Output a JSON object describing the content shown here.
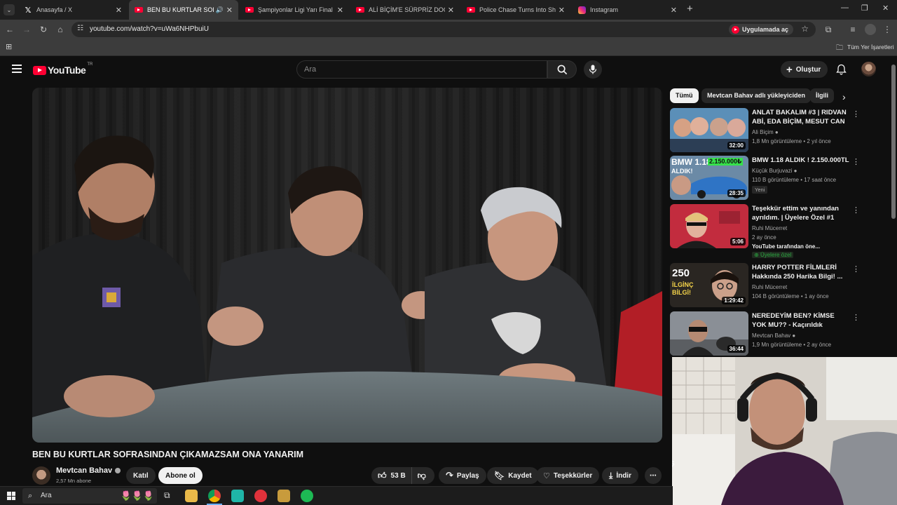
{
  "browser": {
    "tabs": [
      {
        "title": "Anasayfa / X",
        "icon": "x-logo-icon"
      },
      {
        "title": "BEN BU KURTLAR SOFRASIN",
        "icon": "youtube-icon",
        "active": true
      },
      {
        "title": "Şampiyonlar Ligi Yarı Final | Atle",
        "icon": "youtube-icon"
      },
      {
        "title": "ALİ BİÇİM'E SÜRPRİZ DOĞUM G",
        "icon": "youtube-icon"
      },
      {
        "title": "Police Chase Turns Into Shootou",
        "icon": "youtube-icon"
      },
      {
        "title": "Instagram",
        "icon": "instagram-icon"
      }
    ],
    "url": "youtube.com/watch?v=uWa6NHPbuiU",
    "open_in_app": "Uygulamada aç",
    "bookmarks_label": "Tüm Yer İşaretleri"
  },
  "youtube": {
    "logo_text": "YouTube",
    "region": "TR",
    "search_placeholder": "Ara",
    "create_label": "Oluştur"
  },
  "video": {
    "title": "BEN BU KURTLAR SOFRASINDAN ÇIKAMAZSAM ONA YANARIM",
    "channel": "Mevtcan Bahav",
    "subscribers": "2,57 Mn abone",
    "join_label": "Katıl",
    "subscribe_label": "Abone ol",
    "likes": "53 B",
    "share_label": "Paylaş",
    "save_label": "Kaydet",
    "thanks_label": "Teşekkürler",
    "download_label": "İndir"
  },
  "sidebar": {
    "chips": [
      "Tümü",
      "Mevtcan Bahav adlı yükleyiciden",
      "İlgili"
    ],
    "recommendations": [
      {
        "title": "ANLAT BAKALIM #3 | RIDVAN ABİ, EDA BİÇİM, MESUT CAN ...",
        "channel": "Ali Biçim",
        "verified": true,
        "meta": "1,8 Mn görüntüleme • 2 yıl önce",
        "duration": "32:00"
      },
      {
        "title": "BMW 1.18 ALDIK ! 2.150.000TL",
        "channel": "Küçük Burjuvazi",
        "verified": true,
        "meta": "110 B görüntüleme • 17 saat önce",
        "badge": "Yeni",
        "duration": "28:35",
        "thumb_text": "BMW 1.18",
        "thumb_price": "2.150.000₺",
        "thumb_sub": "ALDIK!"
      },
      {
        "title": "Teşekkür ettim ve yanından ayrıldım. | Üyelere Özel #1",
        "channel": "Ruhi Mücerret",
        "verified": false,
        "meta": "2 ay önce",
        "extra": "YouTube tarafından öne...",
        "members": "Üyelere özel",
        "duration": "5:06"
      },
      {
        "title": "HARRY POTTER FİLMLERİ Hakkında 250 Harika Bilgi! ...",
        "channel": "Ruhi Mücerret",
        "verified": false,
        "meta": "104 B görüntüleme • 1 ay önce",
        "duration": "1:29:42",
        "thumb_text": "250",
        "thumb_sub": "İLGİNÇ BİLGİ!"
      },
      {
        "title": "NEREDEYİM BEN? KİMSE YOK MU?? - Kaçırıldık",
        "channel": "Mevtcan Bahav",
        "verified": true,
        "meta": "1,9 Mn görüntüleme • 2 ay önce",
        "duration": "36:44"
      }
    ]
  },
  "taskbar": {
    "search_placeholder": "Ara"
  },
  "colors": {
    "yt_red": "#ff0033",
    "bg": "#0f0f0f",
    "chip": "#272727",
    "subscribe_bg": "#f1f1f1"
  }
}
